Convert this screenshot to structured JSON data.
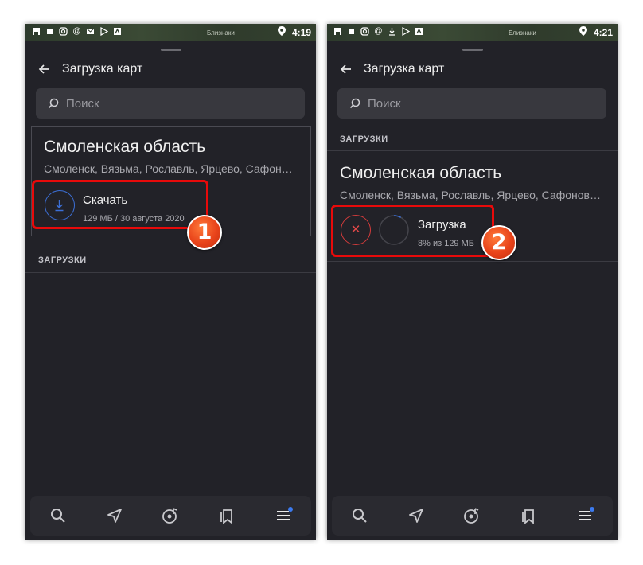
{
  "screens": [
    {
      "status": {
        "time": "4:19",
        "map_label": "Близнаки"
      },
      "header": {
        "title": "Загрузка карт"
      },
      "search": {
        "placeholder": "Поиск"
      },
      "region": {
        "title": "Смоленская область",
        "cities": "Смоленск, Вязьма, Рославль, Ярцево, Сафон…",
        "action_label": "Скачать",
        "meta": "129 МБ / 30 августа 2020"
      },
      "section": {
        "label": "ЗАГРУЗКИ"
      },
      "badge": "1"
    },
    {
      "status": {
        "time": "4:21",
        "map_label": "Близнаки"
      },
      "header": {
        "title": "Загрузка карт"
      },
      "search": {
        "placeholder": "Поиск"
      },
      "section": {
        "label": "ЗАГРУЗКИ"
      },
      "region": {
        "title": "Смоленская область",
        "cities": "Смоленск, Вязьма, Рославль, Ярцево, Сафонов…",
        "action_label": "Загрузка",
        "meta": "8% из 129 МБ",
        "progress": 0.08
      },
      "badge": "2"
    }
  ],
  "bottom_nav": [
    "search-icon",
    "navigation-arrow-icon",
    "music-icon",
    "bookmarks-icon",
    "menu-icon"
  ],
  "colors": {
    "accent": "#3c6fd6",
    "highlight": "#e80a0a",
    "badge": "#e8431a",
    "background": "#222228"
  }
}
